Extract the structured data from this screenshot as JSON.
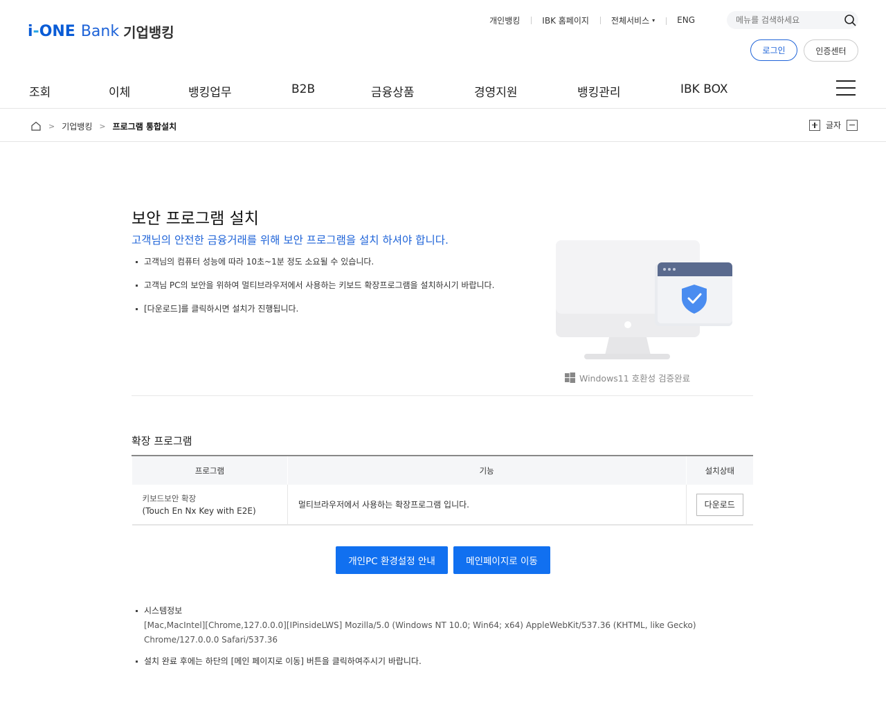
{
  "logo": {
    "brand_prefix": "i",
    "brand_dash": "-",
    "brand_one": "ONE",
    "brand_bank": "Bank",
    "brand_kor": "기업뱅킹"
  },
  "util_nav": [
    "개인뱅킹",
    "IBK 홈페이지",
    "전체서비스",
    "ENG"
  ],
  "util_nav_caret": "▾",
  "search": {
    "placeholder": "메뉴를 검색하세요"
  },
  "auth": {
    "login": "로그인",
    "cert_center": "인증센터"
  },
  "gnb": [
    "조회",
    "이체",
    "뱅킹업무",
    "B2B",
    "금융상품",
    "경영지원",
    "뱅킹관리",
    "IBK BOX"
  ],
  "breadcrumb": {
    "level1": "기업뱅킹",
    "current": "프로그램 통합설치"
  },
  "font_control": {
    "label": "글자"
  },
  "main": {
    "title": "보안 프로그램 설치",
    "subtitle": "고객님의 안전한 금융거래를 위해 보안 프로그램을 설치 하셔야 합니다.",
    "bullets": [
      "고객님의 컴퓨터 성능에 따라 10초~1분 정도 소요될 수 있습니다.",
      "고객님 PC의 보안을 위하여 멀티브라우저에서 사용하는 키보드 확장프로그램을 설치하시기 바랍니다.",
      "[다운로드]를 클릭하시면 설치가 진행됩니다."
    ],
    "windows_note": "Windows11 호환성 검증완료"
  },
  "extension": {
    "title": "확장 프로그램",
    "headers": [
      "프로그램",
      "기능",
      "설치상태"
    ],
    "rows": [
      {
        "name_line1": "키보드보안 확장",
        "name_line2": "(Touch En Nx Key with E2E)",
        "function": "멀티브라우저에서 사용하는 확장프로그램 입니다.",
        "action": "다운로드"
      }
    ]
  },
  "buttons": {
    "pc_guide": "개인PC 환경설정 안내",
    "go_main": "메인페이지로 이동"
  },
  "notes": {
    "sys_label": "시스템정보",
    "sys_value": "[Mac,MacIntel][Chrome,127.0.0.0][IPinsideLWS] Mozilla/5.0 (Windows NT 10.0; Win64; x64) AppleWebKit/537.36 (KHTML, like Gecko) Chrome/127.0.0.0 Safari/537.36",
    "after_install": "설치 완료 후에는 하단의 [메인 페이지로 이동] 버튼을 클릭하여주시기 바랍니다."
  },
  "colors": {
    "brand_blue": "#1e63d8",
    "button_blue": "#1170f0",
    "shield_blue": "#4a8cf0"
  }
}
